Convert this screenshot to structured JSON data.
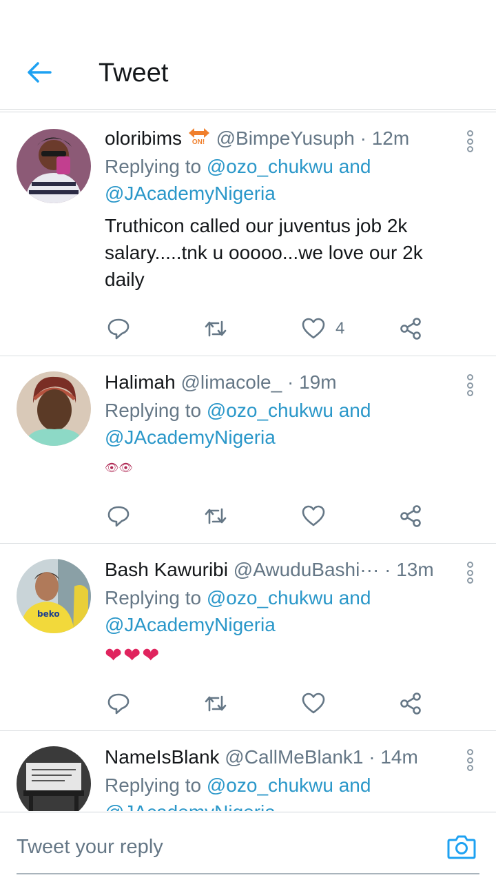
{
  "header": {
    "title": "Tweet"
  },
  "tweets": [
    {
      "name": "oloribims",
      "badge_text": "ON!",
      "handle": "@BimpeYusuph",
      "separator": "·",
      "time": "12m",
      "replying_prefix": "Replying to ",
      "mention_1": "@ozo_chukwu and",
      "mention_2": "@JAcademyNigeria",
      "text": "Truthicon called our juventus job 2k salary.....tnk u ooooo...we love our 2k daily",
      "like_count": "4"
    },
    {
      "name": "Halimah",
      "handle": "@limacole_",
      "separator": "·",
      "time": "19m",
      "replying_prefix": "Replying to ",
      "mention_1": "@ozo_chukwu and",
      "mention_2": "@JAcademyNigeria",
      "text": "👁👁"
    },
    {
      "name": "Bash Kawuribi",
      "handle": "@AwuduBashi···",
      "separator": "·",
      "time": "13m",
      "replying_prefix": "Replying to ",
      "mention_1": "@ozo_chukwu and",
      "mention_2": "@JAcademyNigeria",
      "text": "❤❤❤"
    },
    {
      "name": "NameIsBlank",
      "handle": "@CallMeBlank1",
      "separator": "·",
      "time": "14m",
      "replying_prefix": "Replying to ",
      "mention_1": "@ozo_chukwu and",
      "mention_2": "@JAcademyNigeria"
    }
  ],
  "composer": {
    "placeholder": "Tweet your reply"
  },
  "colors": {
    "accent": "#1da1f2",
    "link": "#2a97c9",
    "heart": "#e0245e",
    "muted": "#657786"
  }
}
